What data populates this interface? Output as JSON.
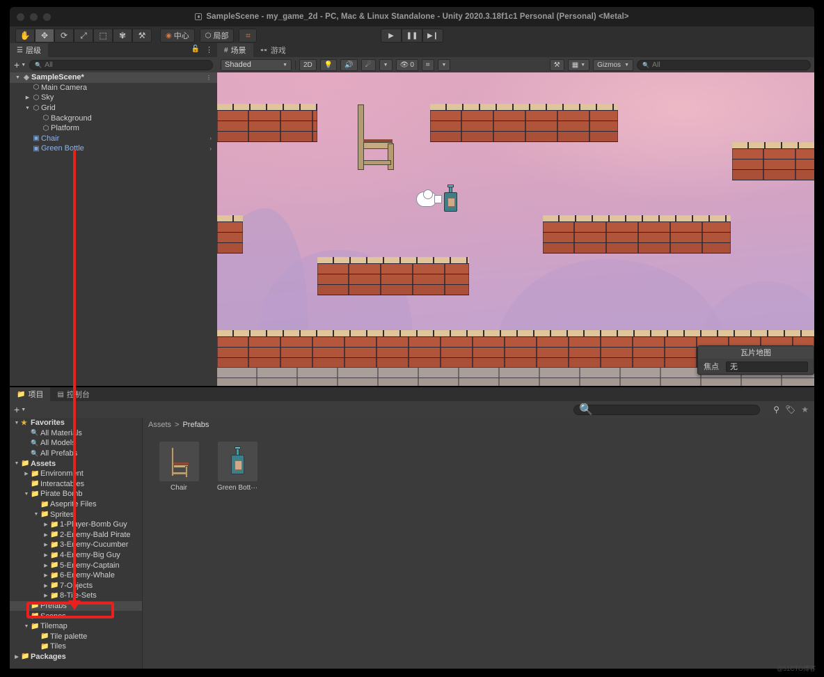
{
  "window": {
    "title": "SampleScene - my_game_2d - PC, Mac & Linux Standalone - Unity 2020.3.18f1c1 Personal (Personal) <Metal>"
  },
  "toolbar": {
    "tools": [
      {
        "name": "hand-tool",
        "glyph": "✋"
      },
      {
        "name": "move-tool",
        "glyph": "✥"
      },
      {
        "name": "rotate-tool",
        "glyph": "⟳"
      },
      {
        "name": "scale-tool",
        "glyph": "⤢"
      },
      {
        "name": "rect-tool",
        "glyph": "⬚"
      },
      {
        "name": "transform-tool",
        "glyph": "✾"
      },
      {
        "name": "custom-tool",
        "glyph": "⚒"
      }
    ],
    "pivot_label": "中心",
    "space_label": "局部",
    "snap_glyph": "⌗",
    "play_label": "▶",
    "pause_label": "❚❚",
    "step_label": "▶❙"
  },
  "hierarchy": {
    "tab_label": "层级",
    "tab_icon": "hierarchy-icon",
    "lock_icon": "🔓",
    "menu_icon": "⋮",
    "add_label": "+",
    "search_placeholder": "All",
    "rows": [
      {
        "label": "SampleScene*",
        "depth": 0,
        "arrow": "▼",
        "icon": "scene-icon",
        "type": "scene"
      },
      {
        "label": "Main Camera",
        "depth": 1,
        "arrow": "",
        "icon": "gameobject-icon",
        "type": "object"
      },
      {
        "label": "Sky",
        "depth": 1,
        "arrow": "▶",
        "icon": "gameobject-icon",
        "type": "object"
      },
      {
        "label": "Grid",
        "depth": 1,
        "arrow": "▼",
        "icon": "gameobject-icon",
        "type": "object"
      },
      {
        "label": "Background",
        "depth": 2,
        "arrow": "",
        "icon": "gameobject-icon",
        "type": "object"
      },
      {
        "label": "Platform",
        "depth": 2,
        "arrow": "",
        "icon": "gameobject-icon",
        "type": "object"
      },
      {
        "label": "Chair",
        "depth": 1,
        "arrow": "",
        "icon": "prefab-icon",
        "type": "prefab"
      },
      {
        "label": "Green Bottle",
        "depth": 1,
        "arrow": "",
        "icon": "prefab-icon",
        "type": "prefab"
      }
    ]
  },
  "scene": {
    "tabs": [
      {
        "label": "场景",
        "icon": "scene-grid-icon",
        "active": true
      },
      {
        "label": "游戏",
        "icon": "game-pad-icon",
        "active": false
      }
    ],
    "draw_mode": "Shaded",
    "mode_2d": "2D",
    "light_icon": "💡",
    "audio_icon": "🔊",
    "fx_icon": "☄",
    "hidden_count": "0",
    "grid_icon": "⌗",
    "tools_icon": "⚒",
    "camera_icon": "▦",
    "gizmos_label": "Gizmos",
    "search_placeholder": "All",
    "overlay": {
      "title": "瓦片地图",
      "focus_label": "焦点",
      "focus_value": "无"
    }
  },
  "project": {
    "tabs": [
      {
        "label": "项目",
        "icon": "folder-icon",
        "active": true
      },
      {
        "label": "控制台",
        "icon": "console-icon",
        "active": false
      }
    ],
    "add_label": "+",
    "search_placeholder": "",
    "right_icons": [
      "asset-filter-icon",
      "label-icon",
      "favorite-star-icon"
    ],
    "breadcrumb": {
      "root": "Assets",
      "sep": ">",
      "current": "Prefabs"
    },
    "tree": [
      {
        "label": "Favorites",
        "depth": 0,
        "arrow": "▼",
        "icon": "star-icon",
        "kind": "fav"
      },
      {
        "label": "All Materials",
        "depth": 1,
        "arrow": "",
        "icon": "search-icon",
        "kind": "search"
      },
      {
        "label": "All Models",
        "depth": 1,
        "arrow": "",
        "icon": "search-icon",
        "kind": "search"
      },
      {
        "label": "All Prefabs",
        "depth": 1,
        "arrow": "",
        "icon": "search-icon",
        "kind": "search"
      },
      {
        "label": "Assets",
        "depth": 0,
        "arrow": "▼",
        "icon": "folder-open-icon",
        "kind": "folder"
      },
      {
        "label": "Environment",
        "depth": 1,
        "arrow": "▶",
        "icon": "folder-icon",
        "kind": "folder"
      },
      {
        "label": "Interactables",
        "depth": 1,
        "arrow": "",
        "icon": "folder-icon",
        "kind": "folder"
      },
      {
        "label": "Pirate Bomb",
        "depth": 1,
        "arrow": "▼",
        "icon": "folder-open-icon",
        "kind": "folder"
      },
      {
        "label": "Aseprite Files",
        "depth": 2,
        "arrow": "",
        "icon": "folder-icon",
        "kind": "folder"
      },
      {
        "label": "Sprites",
        "depth": 2,
        "arrow": "▼",
        "icon": "folder-open-icon",
        "kind": "folder"
      },
      {
        "label": "1-Player-Bomb Guy",
        "depth": 3,
        "arrow": "▶",
        "icon": "folder-icon",
        "kind": "folder"
      },
      {
        "label": "2-Enemy-Bald Pirate",
        "depth": 3,
        "arrow": "▶",
        "icon": "folder-icon",
        "kind": "folder"
      },
      {
        "label": "3-Enemy-Cucumber",
        "depth": 3,
        "arrow": "▶",
        "icon": "folder-icon",
        "kind": "folder"
      },
      {
        "label": "4-Enemy-Big Guy",
        "depth": 3,
        "arrow": "▶",
        "icon": "folder-icon",
        "kind": "folder"
      },
      {
        "label": "5-Enemy-Captain",
        "depth": 3,
        "arrow": "▶",
        "icon": "folder-icon",
        "kind": "folder"
      },
      {
        "label": "6-Enemy-Whale",
        "depth": 3,
        "arrow": "▶",
        "icon": "folder-icon",
        "kind": "folder"
      },
      {
        "label": "7-Objects",
        "depth": 3,
        "arrow": "▶",
        "icon": "folder-icon",
        "kind": "folder"
      },
      {
        "label": "8-Tile-Sets",
        "depth": 3,
        "arrow": "▶",
        "icon": "folder-icon",
        "kind": "folder"
      },
      {
        "label": "Prefabs",
        "depth": 1,
        "arrow": "",
        "icon": "folder-icon",
        "kind": "folder",
        "selected": true
      },
      {
        "label": "Scenes",
        "depth": 1,
        "arrow": "",
        "icon": "folder-icon",
        "kind": "folder"
      },
      {
        "label": "Tilemap",
        "depth": 1,
        "arrow": "▼",
        "icon": "folder-open-icon",
        "kind": "folder"
      },
      {
        "label": "Tile palette",
        "depth": 2,
        "arrow": "",
        "icon": "folder-icon",
        "kind": "folder"
      },
      {
        "label": "Tiles",
        "depth": 2,
        "arrow": "",
        "icon": "folder-icon",
        "kind": "folder"
      },
      {
        "label": "Packages",
        "depth": 0,
        "arrow": "▶",
        "icon": "folder-icon",
        "kind": "folder"
      }
    ],
    "assets": [
      {
        "name": "Chair",
        "thumb": "chair-thumb"
      },
      {
        "name": "Green Bott···",
        "thumb": "bottle-thumb"
      }
    ]
  },
  "annotation": {
    "color": "#e8201e",
    "target": "Prefabs"
  },
  "watermark": "@51CTO博客",
  "colors": {
    "panel_bg": "#383838",
    "toolbar_bg": "#2f2f2f",
    "selection": "#4a4a4a",
    "prefab_blue": "#8fb4e8",
    "accent_orange": "#d07b42",
    "annotation_red": "#e8201e"
  }
}
